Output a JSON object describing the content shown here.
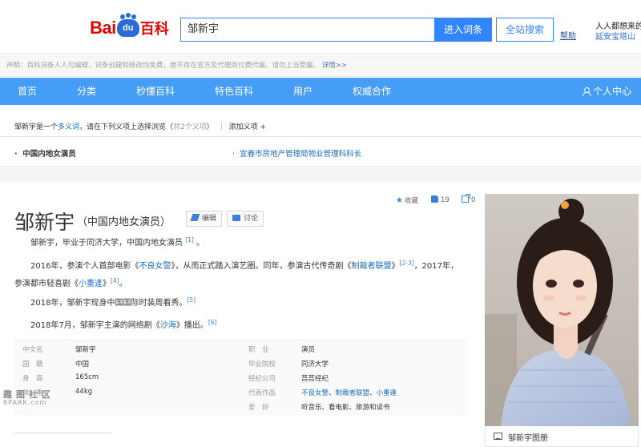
{
  "header": {
    "logo_text": "Bai",
    "logo_du": "du",
    "logo_baike": "百科",
    "search_value": "邹新宇",
    "enter_button": "进入词条",
    "search_button": "全站搜索",
    "help_link": "帮助",
    "hot_label": "人人都想来的",
    "hot_term": "延安宝塔山"
  },
  "notice": {
    "text": "声明：百科词条人人可编辑，词条创建和修改均免费，绝不存在官方及代理商付费代编，请勿上当受骗。",
    "link": "详情>>"
  },
  "nav": {
    "items": [
      "首页",
      "分类",
      "秒懂百科",
      "特色百科",
      "用户",
      "权威合作"
    ],
    "user_center": "个人中心"
  },
  "polysemy": {
    "name": "邹新宇",
    "prefix": "是一个",
    "term": "多义词",
    "middle": "，请在下列义项上选择浏览（",
    "count": "共2个义项",
    "suffix": "）",
    "add": "添加义项",
    "plus": "+",
    "current_sense": "中国内地女演员",
    "other_sense": "宜春市房地产管理局物业管理科科长"
  },
  "entry": {
    "title": "邹新宇",
    "subtitle": "（中国内地女演员）",
    "edit": "编辑",
    "discuss": "讨论",
    "favorite": "收藏",
    "like_count": "19",
    "share_count": "0"
  },
  "paragraphs": {
    "p1": {
      "text": "邹新宇，毕业于同济大学，中国内地女演员",
      "ref": "[1]",
      "end": "。"
    },
    "p2": {
      "t1": "2016年，参演个人首部电影《",
      "film": "不良女警",
      "t2": "》，从而正式踏入演艺圈。同年，参演古代传奇剧《",
      "drama1": "制裁者联盟",
      "t3": "》",
      "ref1": "[2-3]",
      "t4": "，2017年，",
      "t5": "参演都市轻喜剧《",
      "drama2": "小重逢",
      "t6": "》",
      "ref2": "[4]",
      "t7": "。"
    },
    "p3": {
      "text": "2018年，邹新宇现身中国国际时装周看秀。",
      "ref": "[5]"
    },
    "p4": {
      "t1": "2018年7月，邹新宇主演的网络剧《",
      "drama": "沙海",
      "t2": "》播出。",
      "ref": "[6]"
    }
  },
  "basic_info": {
    "left": [
      {
        "label": "中文名",
        "value": "邹新宇"
      },
      {
        "label": "国　籍",
        "value": "中国"
      },
      {
        "label": "身　高",
        "value": "165cm"
      },
      {
        "label": "体　重",
        "value": "44kg"
      }
    ],
    "right": [
      {
        "label": "职　业",
        "value": "演员"
      },
      {
        "label": "毕业院校",
        "value": "同济大学"
      },
      {
        "label": "经纪公司",
        "value": "莒莒经纪"
      },
      {
        "label": "代表作品",
        "works": [
          "不良女警",
          "制裁者联盟",
          "小重逢"
        ],
        "sep": "、"
      },
      {
        "label": "爱　好",
        "value": "听音乐、看电影、旅游和读书"
      }
    ]
  },
  "watermark": {
    "text": "趣图社区",
    "url": "8PARK.com"
  },
  "photo": {
    "caption": "邹新宇图册"
  }
}
